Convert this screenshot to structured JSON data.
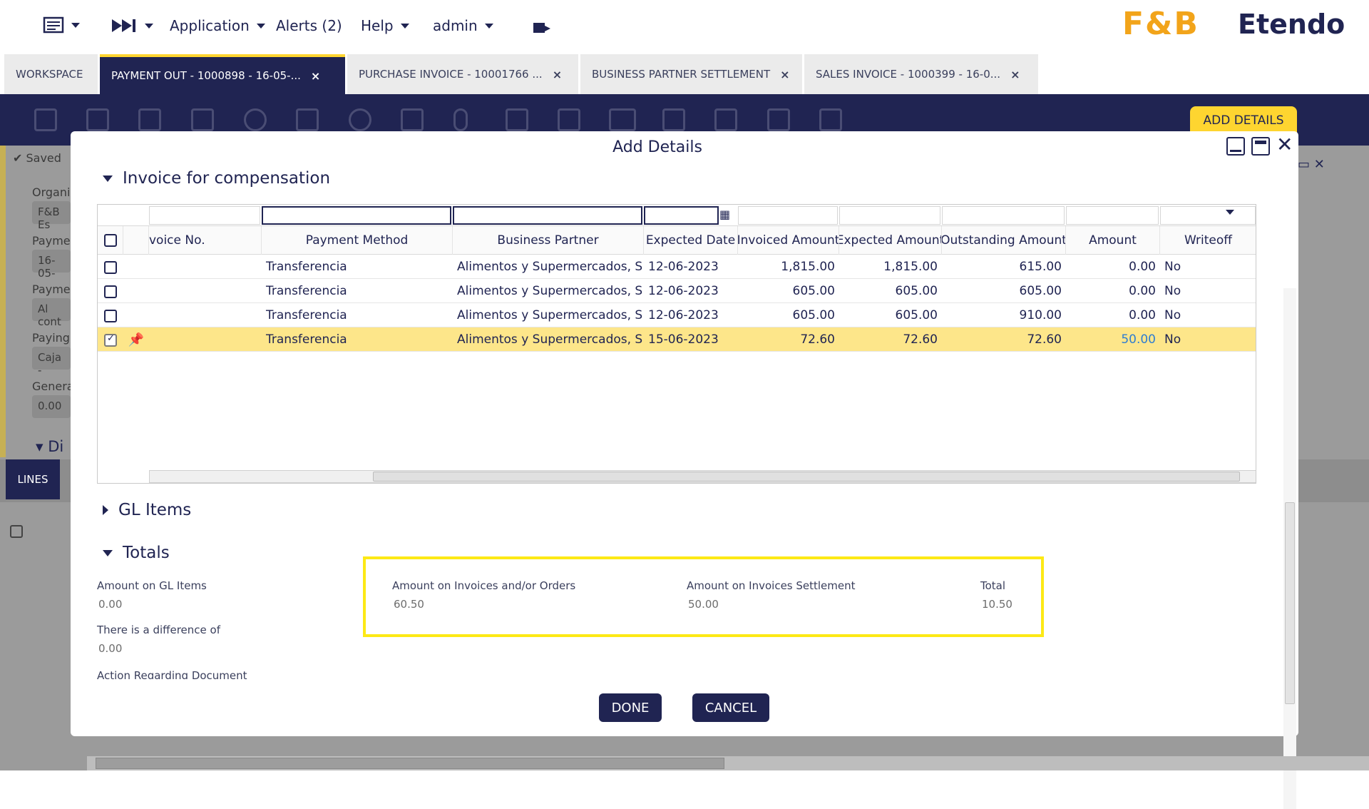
{
  "topbar": {
    "application_label": "Application",
    "alerts_label": "Alerts (2)",
    "help_label": "Help",
    "user_label": "admin",
    "brand_logo": "F&B",
    "brand_name": "Etendo"
  },
  "tabs": [
    {
      "label": "WORKSPACE",
      "active": false,
      "closable": false
    },
    {
      "label": "PAYMENT OUT - 1000898 - 16-05-...",
      "active": true,
      "closable": true
    },
    {
      "label": "PURCHASE INVOICE - 10001766 ...",
      "active": false,
      "closable": true
    },
    {
      "label": "BUSINESS PARTNER SETTLEMENT",
      "active": false,
      "closable": true
    },
    {
      "label": "SALES INVOICE - 1000399 - 16-0...",
      "active": false,
      "closable": true
    }
  ],
  "toolbar": {
    "add_details_label": "ADD DETAILS",
    "icons": [
      "new-document-icon",
      "grid-view-icon",
      "save-icon",
      "save-close-icon",
      "undo-icon",
      "delete-icon",
      "refresh-icon",
      "export-icon",
      "attach-icon",
      "copy-icon",
      "print-icon",
      "email-icon",
      "link-icon",
      "process-icon",
      "form-view-icon",
      "audit-icon"
    ]
  },
  "background_form": {
    "saved_label": "Saved",
    "organization_label": "Organi",
    "organization_value": "F&B Es",
    "payment_label": "Payme",
    "payment_value": "16-05-",
    "payment2_label": "Payme",
    "payment2_value": "Al cont",
    "paying_label": "Paying",
    "paying_value": "Caja -",
    "generated_label": "Genera",
    "generated_value": "0.00",
    "section_label": "Di",
    "lines_tab": "LINES"
  },
  "modal": {
    "title": "Add Details",
    "sections": {
      "invoice": "Invoice for compensation",
      "gl_items": "GL Items",
      "totals": "Totals"
    },
    "grid": {
      "columns": [
        "voice No.",
        "Payment Method",
        "Business Partner",
        "Expected Date",
        "Invoiced Amount",
        "Expected Amount",
        "Outstanding Amount",
        "Amount",
        "Writeoff"
      ],
      "rows": [
        {
          "checked": false,
          "pinned": false,
          "invoice_no": "",
          "payment_method": "Transferencia",
          "business_partner": "Alimentos y Supermercados, S....",
          "expected_date": "12-06-2023",
          "invoiced_amount": "1,815.00",
          "expected_amount": "1,815.00",
          "outstanding_amount": "615.00",
          "amount": "0.00",
          "writeoff": "No"
        },
        {
          "checked": false,
          "pinned": false,
          "invoice_no": "",
          "payment_method": "Transferencia",
          "business_partner": "Alimentos y Supermercados, S....",
          "expected_date": "12-06-2023",
          "invoiced_amount": "605.00",
          "expected_amount": "605.00",
          "outstanding_amount": "605.00",
          "amount": "0.00",
          "writeoff": "No"
        },
        {
          "checked": false,
          "pinned": false,
          "invoice_no": "",
          "payment_method": "Transferencia",
          "business_partner": "Alimentos y Supermercados, S....",
          "expected_date": "12-06-2023",
          "invoiced_amount": "605.00",
          "expected_amount": "605.00",
          "outstanding_amount": "910.00",
          "amount": "0.00",
          "writeoff": "No"
        },
        {
          "checked": true,
          "pinned": true,
          "invoice_no": "",
          "payment_method": "Transferencia",
          "business_partner": "Alimentos y Supermercados, S....",
          "expected_date": "15-06-2023",
          "invoiced_amount": "72.60",
          "expected_amount": "72.60",
          "outstanding_amount": "72.60",
          "amount": "50.00",
          "writeoff": "No"
        }
      ]
    },
    "totals": {
      "gl_items_label": "Amount on GL Items",
      "gl_items_value": "0.00",
      "difference_label": "There is a difference of",
      "difference_value": "0.00",
      "action_label": "Action Regarding Document",
      "invoices_orders_label": "Amount on Invoices and/or Orders",
      "invoices_orders_value": "60.50",
      "settlement_label": "Amount on Invoices Settlement",
      "settlement_value": "50.00",
      "total_label": "Total",
      "total_value": "10.50"
    },
    "done_label": "DONE",
    "cancel_label": "CANCEL"
  },
  "colors": {
    "navy": "#202452",
    "accent_yellow": "#fed530",
    "selected_row": "#fde68a",
    "highlight_border": "#fde915",
    "link_blue": "#2f7dd1"
  }
}
